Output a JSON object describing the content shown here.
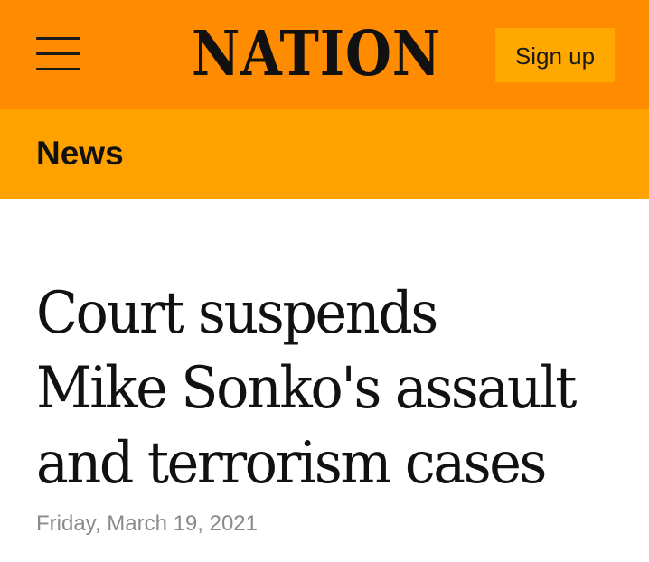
{
  "header": {
    "logo_text": "NATION",
    "signup_label": "Sign up",
    "menu_icon": "hamburger-menu-icon"
  },
  "section": {
    "label": "News"
  },
  "article": {
    "headline_lines": [
      "Court suspends",
      "Mike Sonko's assault",
      "and terrorism cases"
    ],
    "date": "Friday, March 19, 2021"
  },
  "colors": {
    "header_bg": "#ff8b00",
    "section_bg": "#ffa200",
    "signup_bg": "#ffa800",
    "text": "#111111",
    "date_text": "#8a8a8a"
  }
}
